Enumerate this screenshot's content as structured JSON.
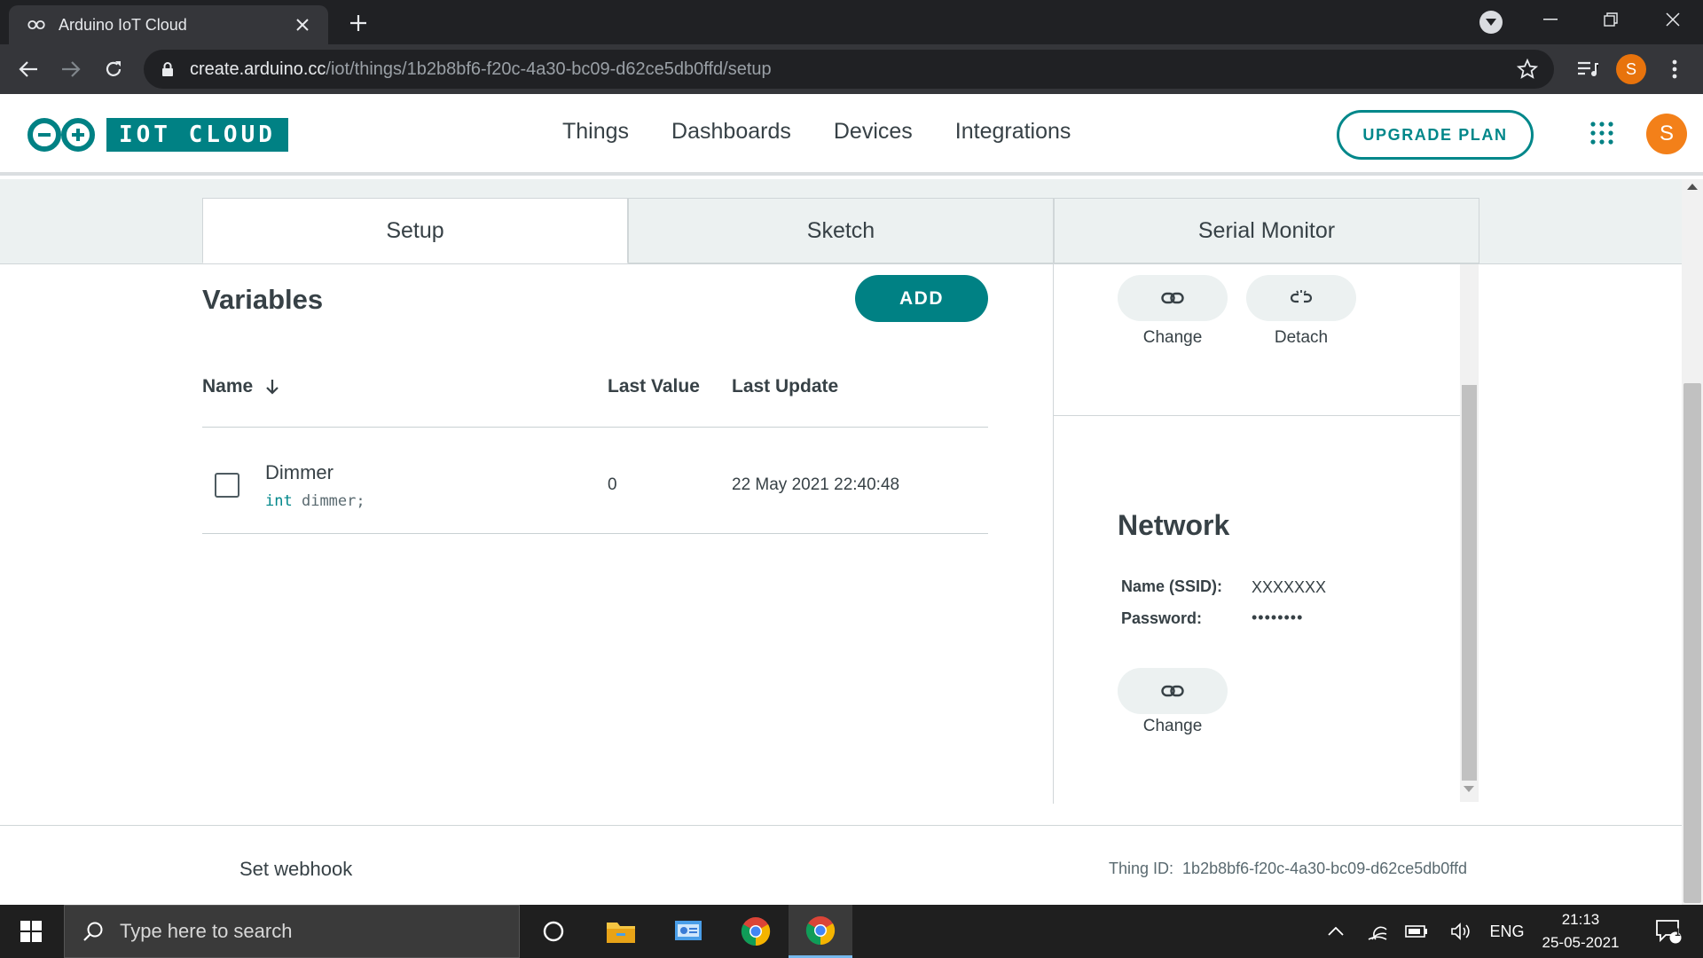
{
  "browser": {
    "tab_title": "Arduino IoT Cloud",
    "url_host": "create.arduino.cc",
    "url_path": "/iot/things/1b2b8bf6-f20c-4a30-bc09-d62ce5db0ffd/setup",
    "profile_initial": "S"
  },
  "header": {
    "logo_text": "IOT CLOUD",
    "nav": [
      "Things",
      "Dashboards",
      "Devices",
      "Integrations"
    ],
    "upgrade_label": "UPGRADE PLAN",
    "user_initial": "S"
  },
  "tabs": [
    {
      "label": "Setup",
      "active": true
    },
    {
      "label": "Sketch",
      "active": false
    },
    {
      "label": "Serial Monitor",
      "active": false
    }
  ],
  "variables": {
    "title": "Variables",
    "add_label": "ADD",
    "columns": {
      "name": "Name",
      "last_value": "Last Value",
      "last_update": "Last Update"
    },
    "rows": [
      {
        "name": "Dimmer",
        "decl_type": "int",
        "decl_name": "dimmer;",
        "last_value": "0",
        "last_update": "22 May 2021 22:40:48"
      }
    ]
  },
  "device": {
    "change_label": "Change",
    "detach_label": "Detach"
  },
  "network": {
    "title": "Network",
    "ssid_label": "Name (SSID):",
    "ssid_value": "XXXXXXX",
    "password_label": "Password:",
    "password_value": "••••••••",
    "change_label": "Change"
  },
  "footer": {
    "webhook_label": "Set webhook",
    "thing_id_label": "Thing ID:",
    "thing_id": "1b2b8bf6-f20c-4a30-bc09-d62ce5db0ffd"
  },
  "taskbar": {
    "search_placeholder": "Type here to search",
    "language": "ENG",
    "time": "21:13",
    "date": "25-05-2021",
    "notification_count": "1"
  },
  "colors": {
    "teal": "#008184",
    "chrome_dark": "#202124",
    "avatar_orange": "#f38019"
  }
}
